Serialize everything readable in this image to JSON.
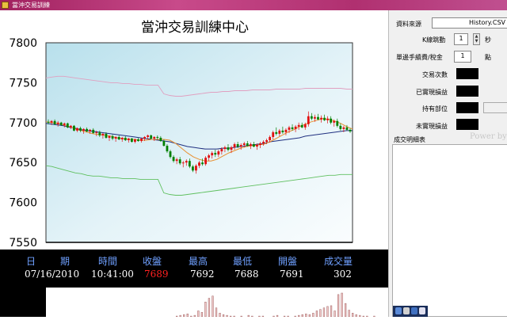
{
  "window": {
    "title": "當沖交易訓練"
  },
  "chart": {
    "title": "當沖交易訓練中心"
  },
  "chart_data": {
    "type": "candlestick",
    "title": "當沖交易訓練中心",
    "yticks": [
      "7800",
      "7750",
      "7700",
      "7650",
      "7600",
      "7550"
    ],
    "ylim": [
      7550,
      7800
    ],
    "grid": false,
    "candles": [
      [
        7701,
        7704,
        7698,
        7700
      ],
      [
        7700,
        7703,
        7697,
        7702
      ],
      [
        7702,
        7704,
        7697,
        7698
      ],
      [
        7698,
        7702,
        7695,
        7700
      ],
      [
        7700,
        7701,
        7696,
        7697
      ],
      [
        7697,
        7700,
        7694,
        7699
      ],
      [
        7699,
        7700,
        7693,
        7694
      ],
      [
        7694,
        7697,
        7692,
        7696
      ],
      [
        7696,
        7697,
        7689,
        7690
      ],
      [
        7690,
        7694,
        7688,
        7693
      ],
      [
        7693,
        7695,
        7688,
        7690
      ],
      [
        7690,
        7693,
        7686,
        7692
      ],
      [
        7692,
        7694,
        7688,
        7689
      ],
      [
        7689,
        7692,
        7686,
        7691
      ],
      [
        7691,
        7693,
        7686,
        7687
      ],
      [
        7687,
        7690,
        7683,
        7688
      ],
      [
        7688,
        7690,
        7682,
        7684
      ],
      [
        7684,
        7687,
        7680,
        7686
      ],
      [
        7686,
        7688,
        7680,
        7681
      ],
      [
        7681,
        7684,
        7677,
        7683
      ],
      [
        7683,
        7685,
        7678,
        7680
      ],
      [
        7680,
        7683,
        7676,
        7682
      ],
      [
        7682,
        7684,
        7678,
        7679
      ],
      [
        7679,
        7682,
        7676,
        7681
      ],
      [
        7681,
        7683,
        7677,
        7678
      ],
      [
        7678,
        7681,
        7675,
        7680
      ],
      [
        7680,
        7681,
        7675,
        7676
      ],
      [
        7676,
        7680,
        7674,
        7679
      ],
      [
        7679,
        7681,
        7676,
        7677
      ],
      [
        7677,
        7681,
        7675,
        7680
      ],
      [
        7680,
        7683,
        7677,
        7682
      ],
      [
        7682,
        7685,
        7679,
        7684
      ],
      [
        7684,
        7685,
        7679,
        7680
      ],
      [
        7680,
        7683,
        7677,
        7682
      ],
      [
        7682,
        7684,
        7679,
        7681
      ],
      [
        7681,
        7683,
        7676,
        7677
      ],
      [
        7677,
        7679,
        7670,
        7671
      ],
      [
        7671,
        7673,
        7662,
        7664
      ],
      [
        7664,
        7666,
        7655,
        7657
      ],
      [
        7657,
        7659,
        7650,
        7652
      ],
      [
        7652,
        7656,
        7648,
        7654
      ],
      [
        7654,
        7657,
        7647,
        7649
      ],
      [
        7649,
        7652,
        7644,
        7650
      ],
      [
        7650,
        7654,
        7646,
        7652
      ],
      [
        7652,
        7655,
        7643,
        7645
      ],
      [
        7645,
        7647,
        7638,
        7640
      ],
      [
        7640,
        7648,
        7636,
        7646
      ],
      [
        7646,
        7652,
        7643,
        7650
      ],
      [
        7650,
        7655,
        7646,
        7648
      ],
      [
        7648,
        7658,
        7646,
        7656
      ],
      [
        7656,
        7661,
        7652,
        7659
      ],
      [
        7659,
        7664,
        7655,
        7662
      ],
      [
        7662,
        7666,
        7657,
        7660
      ],
      [
        7660,
        7666,
        7657,
        7664
      ],
      [
        7664,
        7669,
        7660,
        7667
      ],
      [
        7667,
        7671,
        7663,
        7669
      ],
      [
        7669,
        7673,
        7664,
        7666
      ],
      [
        7666,
        7671,
        7662,
        7669
      ],
      [
        7669,
        7675,
        7666,
        7673
      ],
      [
        7673,
        7676,
        7668,
        7670
      ],
      [
        7670,
        7674,
        7666,
        7672
      ],
      [
        7672,
        7676,
        7669,
        7674
      ],
      [
        7674,
        7677,
        7670,
        7671
      ],
      [
        7671,
        7675,
        7667,
        7673
      ],
      [
        7673,
        7676,
        7669,
        7670
      ],
      [
        7670,
        7674,
        7666,
        7672
      ],
      [
        7672,
        7676,
        7668,
        7674
      ],
      [
        7674,
        7678,
        7671,
        7676
      ],
      [
        7676,
        7680,
        7673,
        7678
      ],
      [
        7678,
        7684,
        7675,
        7682
      ],
      [
        7682,
        7690,
        7679,
        7688
      ],
      [
        7688,
        7694,
        7684,
        7686
      ],
      [
        7686,
        7692,
        7683,
        7690
      ],
      [
        7690,
        7695,
        7686,
        7688
      ],
      [
        7688,
        7693,
        7684,
        7691
      ],
      [
        7691,
        7696,
        7687,
        7694
      ],
      [
        7694,
        7698,
        7690,
        7692
      ],
      [
        7692,
        7697,
        7688,
        7695
      ],
      [
        7695,
        7700,
        7691,
        7697
      ],
      [
        7697,
        7700,
        7693,
        7694
      ],
      [
        7694,
        7700,
        7691,
        7698
      ],
      [
        7698,
        7714,
        7695,
        7708
      ],
      [
        7708,
        7712,
        7703,
        7705
      ],
      [
        7705,
        7710,
        7701,
        7707
      ],
      [
        7707,
        7711,
        7703,
        7704
      ],
      [
        7704,
        7709,
        7700,
        7706
      ],
      [
        7706,
        7710,
        7702,
        7703
      ],
      [
        7703,
        7708,
        7699,
        7705
      ],
      [
        7705,
        7708,
        7698,
        7700
      ],
      [
        7700,
        7704,
        7695,
        7702
      ],
      [
        7702,
        7705,
        7694,
        7696
      ],
      [
        7696,
        7699,
        7690,
        7692
      ],
      [
        7692,
        7696,
        7688,
        7694
      ],
      [
        7694,
        7697,
        7690,
        7691
      ],
      [
        7691,
        7693,
        7687,
        7689
      ]
    ],
    "ma_short": [
      7701,
      7700,
      7699,
      7697,
      7695,
      7692,
      7690,
      7688,
      7686,
      7685,
      7684,
      7683,
      7681,
      7680,
      7679,
      7679,
      7678,
      7678,
      7679,
      7679,
      7679,
      7678,
      7674,
      7668,
      7662,
      7657,
      7654,
      7652,
      7652,
      7654,
      7658,
      7662,
      7665,
      7668,
      7670,
      7671,
      7672,
      7673,
      7676,
      7680,
      7684,
      7688,
      7691,
      7695,
      7698,
      7701,
      7703,
      7705,
      7704,
      7702,
      7699,
      7695,
      7692
    ],
    "ma_long": [
      7699,
      7698,
      7697,
      7696,
      7694,
      7693,
      7691,
      7690,
      7689,
      7688,
      7687,
      7686,
      7685,
      7684,
      7683,
      7682,
      7681,
      7680,
      7679,
      7678,
      7677,
      7676,
      7674,
      7672,
      7670,
      7669,
      7668,
      7667,
      7667,
      7667,
      7668,
      7668,
      7669,
      7670,
      7671,
      7672,
      7673,
      7674,
      7676,
      7677,
      7678,
      7679,
      7680,
      7681,
      7683,
      7684,
      7685,
      7686,
      7687,
      7688,
      7689,
      7690,
      7690
    ],
    "upper_band": [
      7756,
      7757,
      7758,
      7758,
      7757,
      7756,
      7755,
      7754,
      7753,
      7752,
      7751,
      7750,
      7750,
      7749,
      7749,
      7748,
      7748,
      7747,
      7747,
      7747,
      7736,
      7734,
      7733,
      7733,
      7734,
      7735,
      7736,
      7737,
      7738,
      7738,
      7739,
      7739,
      7740,
      7740,
      7740,
      7741,
      7741,
      7741,
      7741,
      7742,
      7742,
      7742,
      7742,
      7742,
      7743,
      7743,
      7743,
      7743,
      7743,
      7743,
      7743,
      7742,
      7742
    ],
    "lower_band": [
      7646,
      7645,
      7643,
      7641,
      7639,
      7637,
      7636,
      7634,
      7633,
      7633,
      7632,
      7631,
      7631,
      7630,
      7630,
      7630,
      7629,
      7629,
      7629,
      7629,
      7612,
      7610,
      7609,
      7609,
      7610,
      7611,
      7612,
      7613,
      7614,
      7615,
      7616,
      7617,
      7618,
      7619,
      7620,
      7621,
      7622,
      7623,
      7624,
      7625,
      7626,
      7627,
      7628,
      7629,
      7630,
      7631,
      7632,
      7633,
      7634,
      7634,
      7635,
      7635,
      7635
    ],
    "volume": [
      0,
      0,
      0,
      0,
      0,
      0,
      0,
      0,
      0,
      0,
      0,
      0,
      0,
      0,
      0,
      0,
      0,
      0,
      0,
      0,
      0,
      0,
      0,
      0,
      0,
      0,
      0,
      0,
      0,
      0,
      0,
      0,
      0,
      0,
      0,
      0,
      1,
      2,
      3,
      4,
      1,
      2,
      8,
      6,
      20,
      25,
      28,
      12,
      5,
      3,
      2,
      1,
      1,
      0,
      1,
      0,
      2,
      1,
      0,
      1,
      1,
      0,
      0,
      1,
      2,
      0,
      1,
      1,
      0,
      1,
      2,
      3,
      4,
      3,
      5,
      8,
      10,
      12,
      14,
      15,
      8,
      30,
      32,
      18,
      9,
      5,
      3,
      2,
      1,
      1,
      0,
      1,
      0,
      0,
      0
    ]
  },
  "quote": {
    "headers": [
      "日",
      "期",
      "時間",
      "收盤",
      "最高",
      "最低",
      "開盤",
      "成交量"
    ],
    "values": {
      "date": "07/16/2010",
      "time": "10:41:00",
      "close": "7689",
      "high": "7692",
      "low": "7688",
      "open": "7691",
      "volume": "302"
    }
  },
  "panel": {
    "source_label": "資料來源",
    "source_value": "History.CSV",
    "kbar_label": "K線跳動",
    "kbar_value": "1",
    "kbar_unit": "秒",
    "fee_label": "單邊手續費/稅金",
    "fee_value": "1",
    "fee_unit": "點",
    "trades_label": "交易次數",
    "realized_label": "已實現損益",
    "position_label": "持有部位",
    "unrealized_label": "未實現損益",
    "detail_label": "成交明細表",
    "powered_label": "Power by"
  },
  "colors": {
    "up": "#e01010",
    "down": "#008000",
    "close_value": "#ff2020",
    "header_text": "#6fa0ff"
  }
}
